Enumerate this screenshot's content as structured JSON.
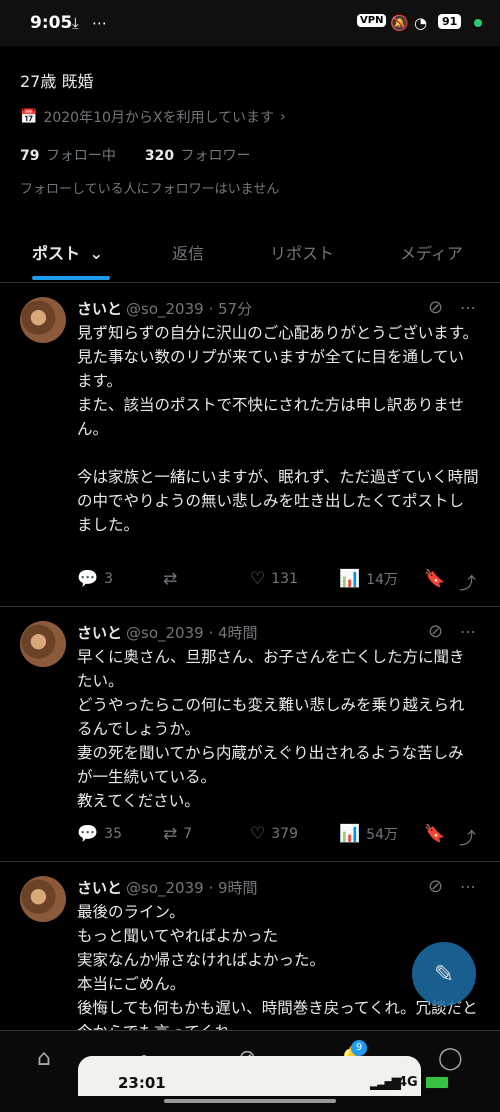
{
  "status_bar": {
    "time": "9:05",
    "vpn": "VPN",
    "battery": "91",
    "icons": [
      "download-icon",
      "more-icon",
      "mute-icon",
      "wifi-icon"
    ]
  },
  "profile": {
    "bio": "27歳 既婚",
    "joined": "2020年10月からXを利用しています",
    "following_count": "79",
    "following_label": "フォロー中",
    "followers_count": "320",
    "followers_label": "フォロワー",
    "no_known_followers": "フォローしている人にフォロワーはいません"
  },
  "tabs": [
    {
      "label": "ポスト",
      "active": true
    },
    {
      "label": "返信",
      "active": false
    },
    {
      "label": "リポスト",
      "active": false
    },
    {
      "label": "メディア",
      "active": false
    }
  ],
  "posts": [
    {
      "name": "さいと",
      "handle": "@so_2039",
      "time": "57分",
      "text": "見ず知らずの自分に沢山のご心配ありがとうございます。\n見た事ない数のリプが来ていますが全てに目を通しています。\nまた、該当のポストで不快にされた方は申し訳ありません。\n\n今は家族と一緒にいますが、眠れず、ただ過ぎていく時間の中でやりようの無い悲しみを吐き出したくてポストしました。",
      "replies": "3",
      "reposts": "",
      "likes": "131",
      "views": "14万"
    },
    {
      "name": "さいと",
      "handle": "@so_2039",
      "time": "4時間",
      "text": "早くに奥さん、旦那さん、お子さんを亡くした方に聞きたい。\nどうやったらこの何にも変え難い悲しみを乗り越えられるんでしょうか。\n妻の死を聞いてから内蔵がえぐり出されるような苦しみが一生続いている。\n教えてください。",
      "replies": "35",
      "reposts": "7",
      "likes": "379",
      "views": "54万"
    },
    {
      "name": "さいと",
      "handle": "@so_2039",
      "time": "9時間",
      "text": "最後のライン。\nもっと聞いてやればよかった\n実家なんか帰さなければよかった。\n本当にごめん。\n後悔しても何もかも遅い、時間巻き戻ってくれ。冗談だと今からでも言ってくれ。",
      "replies": "",
      "reposts": "",
      "likes": "",
      "views": ""
    }
  ],
  "bottom_nav": {
    "notification_badge": "9"
  },
  "pip_overlay": {
    "time": "23:01",
    "network": "4G"
  },
  "colors": {
    "accent": "#1d9bf0",
    "background": "#000000",
    "muted": "#71767b"
  }
}
